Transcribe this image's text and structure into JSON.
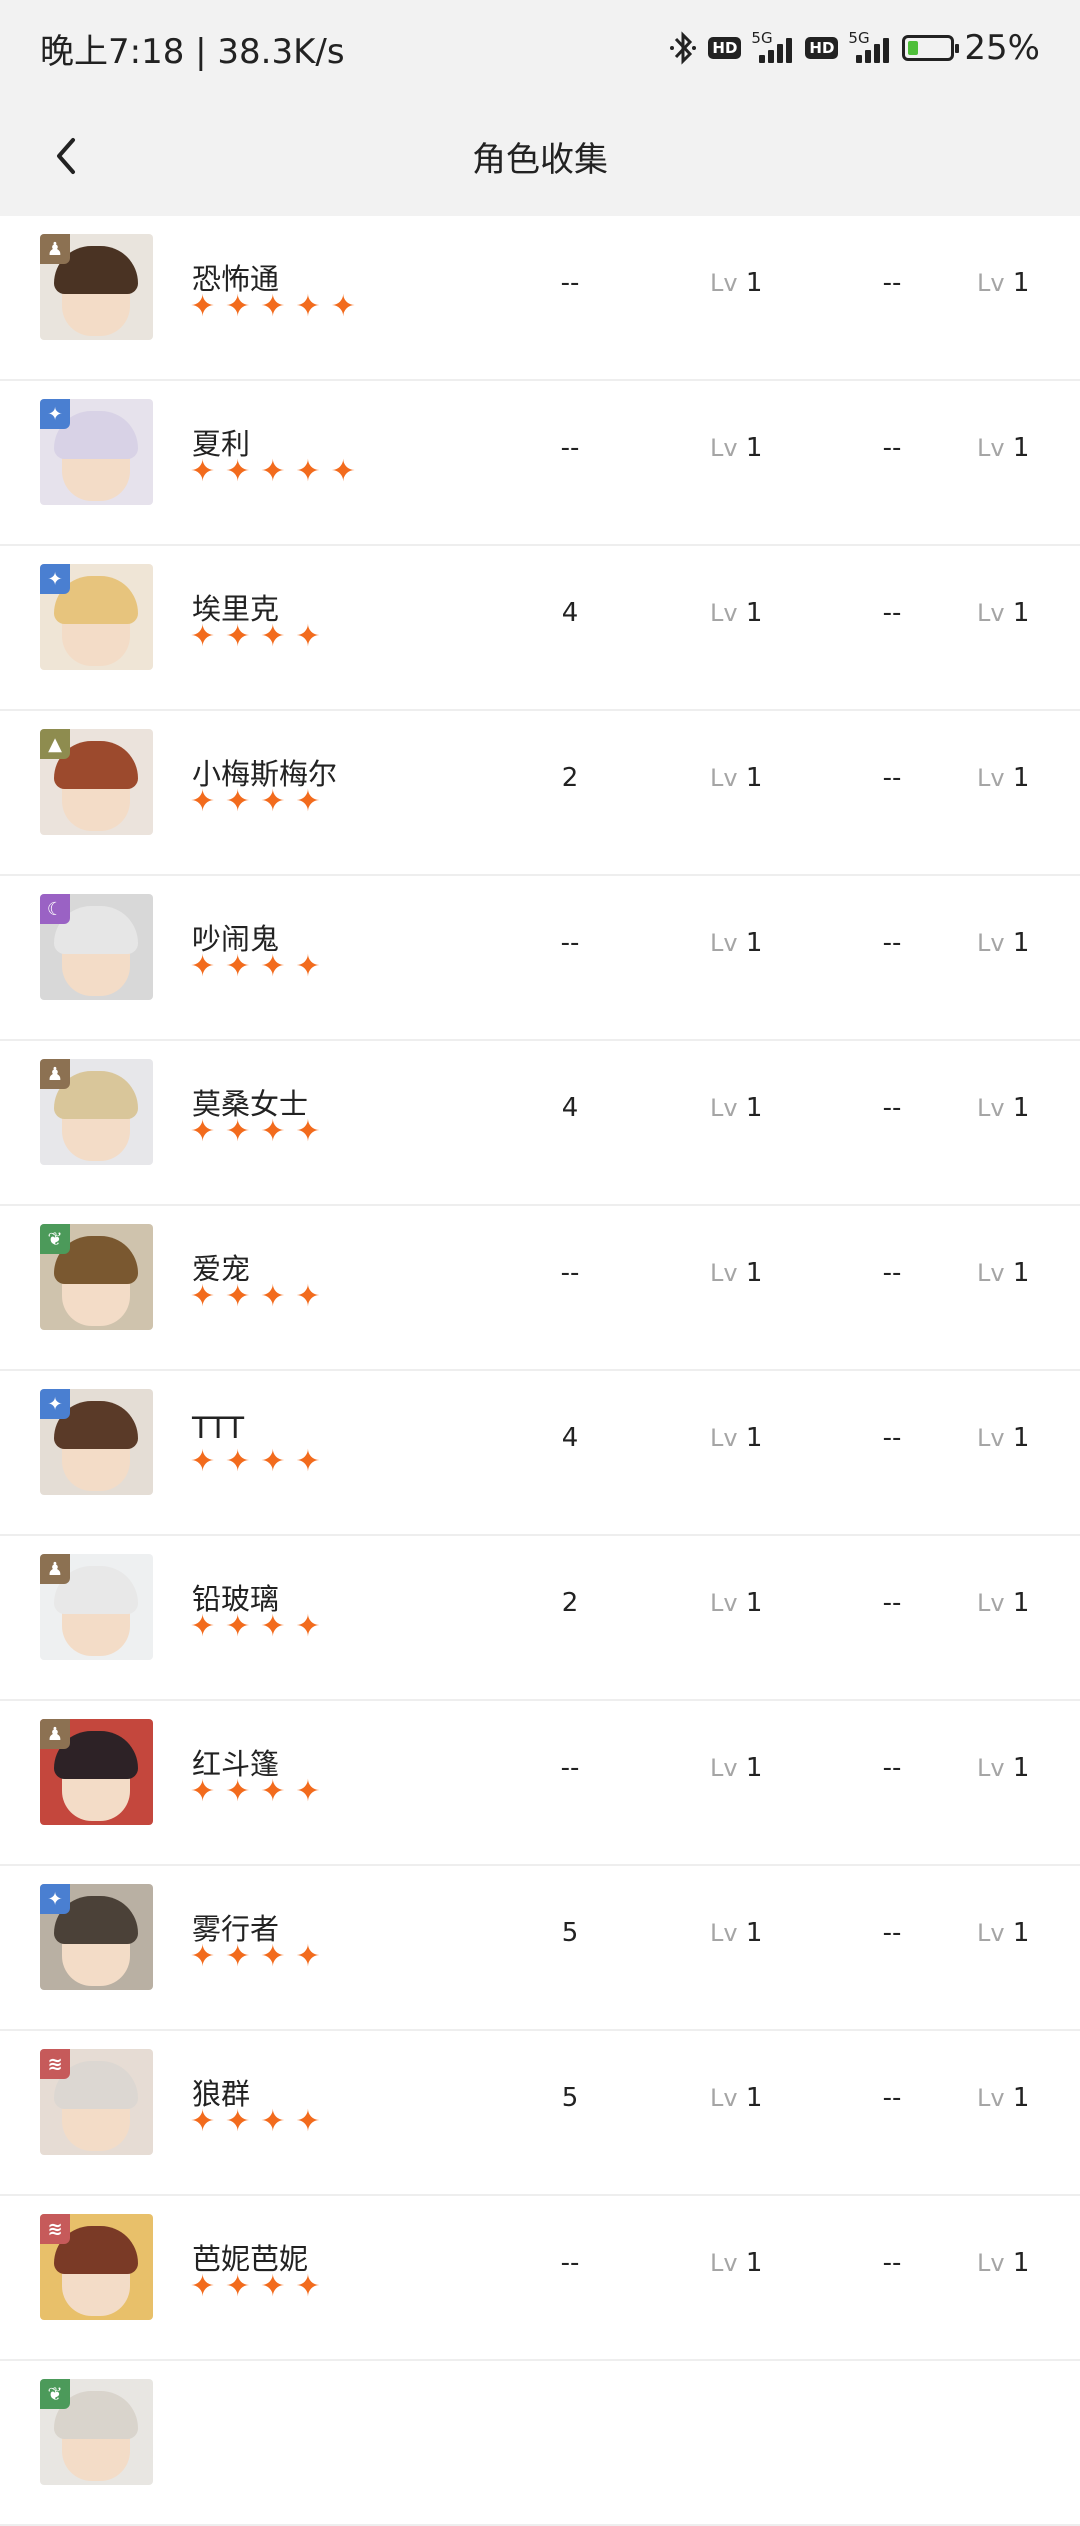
{
  "status_bar": {
    "time": "晚上7:18 | 38.3K/s",
    "hd1": "HD",
    "net1": "5G",
    "hd2": "HD",
    "net2": "5G",
    "battery": "25%",
    "battery_level": 0.25
  },
  "header": {
    "title": "角色收集"
  },
  "colors": {
    "star": "#f26b1d",
    "text": "#222222",
    "muted": "#a5a5a5",
    "divider": "#eeeeee"
  },
  "characters": [
    {
      "name": "恐怖通",
      "stars": 5,
      "col1": "--",
      "lv1_label": "Lv",
      "lv1": "1",
      "col3": "--",
      "lv2_label": "Lv",
      "lv2": "1",
      "badge_color": "#8c7152",
      "badge_icon": "mind-icon",
      "hair": "#4a3323",
      "bg": "#e9e4dd"
    },
    {
      "name": "夏利",
      "stars": 5,
      "col1": "--",
      "lv1_label": "Lv",
      "lv1": "1",
      "col3": "--",
      "lv2_label": "Lv",
      "lv2": "1",
      "badge_color": "#4a7fd1",
      "badge_icon": "star-icon",
      "hair": "#d8d2e6",
      "bg": "#e6e2ec"
    },
    {
      "name": "埃里克",
      "stars": 4,
      "col1": "4",
      "lv1_label": "Lv",
      "lv1": "1",
      "col3": "--",
      "lv2_label": "Lv",
      "lv2": "1",
      "badge_color": "#4a7fd1",
      "badge_icon": "star-icon",
      "hair": "#e7c47d",
      "bg": "#efe5d6"
    },
    {
      "name": "小梅斯梅尔",
      "stars": 4,
      "col1": "2",
      "lv1_label": "Lv",
      "lv1": "1",
      "col3": "--",
      "lv2_label": "Lv",
      "lv2": "1",
      "badge_color": "#8e8c4f",
      "badge_icon": "triangle-icon",
      "hair": "#9c4a2d",
      "bg": "#ebe3dc"
    },
    {
      "name": "吵闹鬼",
      "stars": 4,
      "col1": "--",
      "lv1_label": "Lv",
      "lv1": "1",
      "col3": "--",
      "lv2_label": "Lv",
      "lv2": "1",
      "badge_color": "#9a62c4",
      "badge_icon": "moon-icon",
      "hair": "#e6e6e6",
      "bg": "#d8d8d8"
    },
    {
      "name": "莫桑女士",
      "stars": 4,
      "col1": "4",
      "lv1_label": "Lv",
      "lv1": "1",
      "col3": "--",
      "lv2_label": "Lv",
      "lv2": "1",
      "badge_color": "#8c7152",
      "badge_icon": "mind-icon",
      "hair": "#d9c69a",
      "bg": "#e7e7ea"
    },
    {
      "name": "爱宠",
      "stars": 4,
      "col1": "--",
      "lv1_label": "Lv",
      "lv1": "1",
      "col3": "--",
      "lv2_label": "Lv",
      "lv2": "1",
      "badge_color": "#4c9a5a",
      "badge_icon": "leaf-icon",
      "hair": "#7a5830",
      "bg": "#cfc3ad"
    },
    {
      "name": "TTT",
      "stars": 4,
      "col1": "4",
      "lv1_label": "Lv",
      "lv1": "1",
      "col3": "--",
      "lv2_label": "Lv",
      "lv2": "1",
      "badge_color": "#4a7fd1",
      "badge_icon": "star-icon",
      "hair": "#5a3a28",
      "bg": "#e4ddd5"
    },
    {
      "name": "铅玻璃",
      "stars": 4,
      "col1": "2",
      "lv1_label": "Lv",
      "lv1": "1",
      "col3": "--",
      "lv2_label": "Lv",
      "lv2": "1",
      "badge_color": "#8c7152",
      "badge_icon": "mind-icon",
      "hair": "#e8e8e8",
      "bg": "#eef0f1"
    },
    {
      "name": "红斗篷",
      "stars": 4,
      "col1": "--",
      "lv1_label": "Lv",
      "lv1": "1",
      "col3": "--",
      "lv2_label": "Lv",
      "lv2": "1",
      "badge_color": "#8c7152",
      "badge_icon": "mind-icon",
      "hair": "#2d2226",
      "bg": "#c4473d"
    },
    {
      "name": "雾行者",
      "stars": 4,
      "col1": "5",
      "lv1_label": "Lv",
      "lv1": "1",
      "col3": "--",
      "lv2_label": "Lv",
      "lv2": "1",
      "badge_color": "#4a7fd1",
      "badge_icon": "star-icon",
      "hair": "#4b4138",
      "bg": "#b9b0a3"
    },
    {
      "name": "狼群",
      "stars": 4,
      "col1": "5",
      "lv1_label": "Lv",
      "lv1": "1",
      "col3": "--",
      "lv2_label": "Lv",
      "lv2": "1",
      "badge_color": "#c65a5a",
      "badge_icon": "claw-icon",
      "hair": "#dcd7d2",
      "bg": "#e6dcd4"
    },
    {
      "name": "芭妮芭妮",
      "stars": 4,
      "col1": "--",
      "lv1_label": "Lv",
      "lv1": "1",
      "col3": "--",
      "lv2_label": "Lv",
      "lv2": "1",
      "badge_color": "#c65a5a",
      "badge_icon": "claw-icon",
      "hair": "#7a3a26",
      "bg": "#e8c06a"
    },
    {
      "name": "",
      "stars": 0,
      "col1": "",
      "lv1_label": "",
      "lv1": "",
      "col3": "",
      "lv2_label": "",
      "lv2": "",
      "badge_color": "#4c9a5a",
      "badge_icon": "leaf-icon",
      "hair": "#d9d4cc",
      "bg": "#e8e6e2"
    }
  ]
}
